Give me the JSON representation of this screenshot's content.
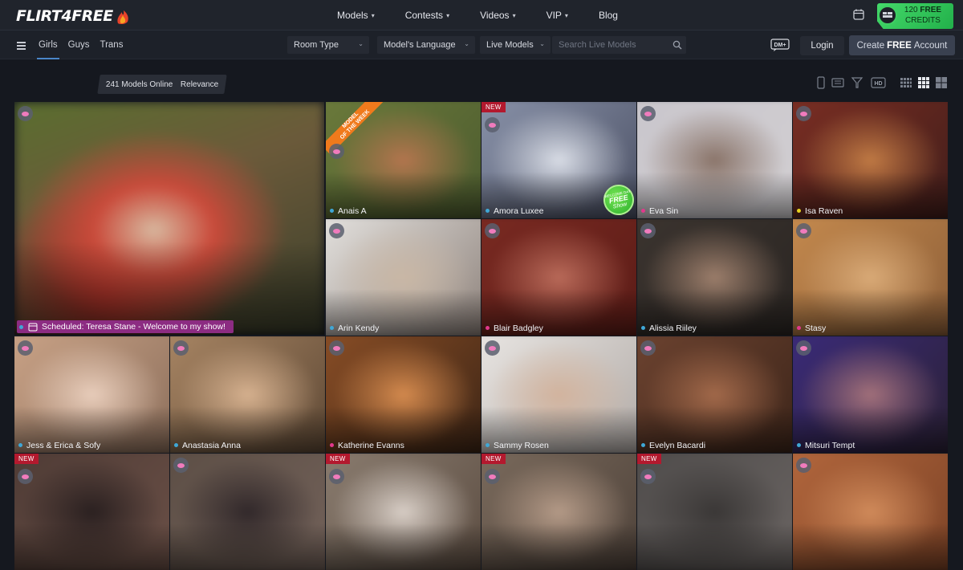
{
  "header": {
    "logo_text": "FLIRT4FREE",
    "nav": [
      {
        "label": "Models",
        "has_dropdown": true
      },
      {
        "label": "Contests",
        "has_dropdown": true
      },
      {
        "label": "Videos",
        "has_dropdown": true
      },
      {
        "label": "VIP",
        "has_dropdown": true
      },
      {
        "label": "Blog",
        "has_dropdown": false
      }
    ],
    "credits": {
      "amount": "120",
      "free": "FREE",
      "label": "CREDITS"
    }
  },
  "subbar": {
    "categories": [
      "Girls",
      "Guys",
      "Trans"
    ],
    "active_category": "Girls",
    "filters": {
      "room_type": "Room Type",
      "language": "Model's Language",
      "live": "Live Models"
    },
    "search_placeholder": "Search Live Models",
    "dm_label": "DM+",
    "login_label": "Login",
    "create_prefix": "Create",
    "create_bold": "FREE",
    "create_suffix": "Account"
  },
  "info": {
    "online": "241 Models Online",
    "sort": "Relevance"
  },
  "badges": {
    "new": "NEW",
    "motw_line1": "MODEL",
    "motw_line2": "OF THE WEEK",
    "welcome_line1": "WELCOME DAY",
    "welcome_line2": "FREE",
    "welcome_line3": "Show",
    "hd": "HD"
  },
  "featured": {
    "scheduled_text": "Scheduled: Teresa Stane - Welcome to my show!",
    "colors": [
      "#5a6e2f",
      "#c94a3a",
      "#d8b9a0",
      "#a8241f"
    ]
  },
  "status_colors": {
    "blue": "#3fa7d6",
    "pink": "#e2388c",
    "yellow": "#e6d11f"
  },
  "models": [
    {
      "name": "Anais A",
      "status": "blue",
      "new": false,
      "badge": "motw",
      "colors": [
        "#6b7a3b",
        "#b3754e",
        "#4b5a2e"
      ]
    },
    {
      "name": "Amora Luxee",
      "status": "blue",
      "new": true,
      "badge": "welcome",
      "colors": [
        "#8a93aa",
        "#d9dde6",
        "#4a4f63"
      ]
    },
    {
      "name": "Eva Sin",
      "status": "pink",
      "new": false,
      "badge": "",
      "colors": [
        "#c9c6cc",
        "#8a7469",
        "#d2cfd2"
      ]
    },
    {
      "name": "Isa Raven",
      "status": "yellow",
      "new": false,
      "badge": "",
      "colors": [
        "#7b2e23",
        "#c07a44",
        "#3f1d1a"
      ]
    },
    {
      "name": "Arin Kendy",
      "status": "blue",
      "new": false,
      "badge": "",
      "colors": [
        "#e5e3e0",
        "#c9b7a5",
        "#8b7f78"
      ]
    },
    {
      "name": "Blair Badgley",
      "status": "pink",
      "new": false,
      "badge": "",
      "colors": [
        "#7a2a22",
        "#b96a59",
        "#5a1b16"
      ]
    },
    {
      "name": "Alissia Riiley",
      "status": "blue",
      "new": false,
      "badge": "",
      "colors": [
        "#3b342f",
        "#9c7e6b",
        "#2a2522"
      ]
    },
    {
      "name": "Stasy",
      "status": "pink",
      "new": false,
      "badge": "",
      "colors": [
        "#c58a4e",
        "#d9aa77",
        "#8b5d37"
      ]
    },
    {
      "name": "Jess & Erica & Sofy",
      "status": "blue",
      "new": false,
      "badge": "",
      "colors": [
        "#caa387",
        "#e8cdbb",
        "#8a6d5a"
      ]
    },
    {
      "name": "Anastasia Anna",
      "status": "blue",
      "new": false,
      "badge": "",
      "colors": [
        "#a98664",
        "#d6b18f",
        "#5b4633"
      ]
    },
    {
      "name": "Katherine Evanns",
      "status": "pink",
      "new": false,
      "badge": "",
      "colors": [
        "#8a4e26",
        "#d48a4e",
        "#3b2415"
      ]
    },
    {
      "name": "Sammy Rosen",
      "status": "blue",
      "new": false,
      "badge": "",
      "colors": [
        "#e9e6e3",
        "#d2b39d",
        "#b0a9a5"
      ]
    },
    {
      "name": "Evelyn Bacardi",
      "status": "blue",
      "new": false,
      "badge": "",
      "colors": [
        "#6d4330",
        "#a2694a",
        "#3b2419"
      ]
    },
    {
      "name": "Mitsuri Tempt",
      "status": "blue",
      "new": false,
      "badge": "",
      "colors": [
        "#3b2b7a",
        "#a2707a",
        "#2a2033"
      ]
    },
    {
      "name": "",
      "status": "",
      "new": true,
      "badge": "",
      "colors": [
        "#4e3b35",
        "#2a2020",
        "#6b5047"
      ]
    },
    {
      "name": "",
      "status": "",
      "new": false,
      "badge": "",
      "colors": [
        "#5c4e45",
        "#31282a",
        "#73625a"
      ]
    },
    {
      "name": "",
      "status": "",
      "new": true,
      "badge": "",
      "colors": [
        "#8b7d70",
        "#d8cec6",
        "#5a4b40"
      ]
    },
    {
      "name": "",
      "status": "",
      "new": true,
      "badge": "",
      "colors": [
        "#7b6b5d",
        "#b49a87",
        "#4c4038"
      ]
    },
    {
      "name": "",
      "status": "",
      "new": true,
      "badge": "",
      "colors": [
        "#4e4b4a",
        "#3a3736",
        "#6b6563"
      ]
    },
    {
      "name": "",
      "status": "",
      "new": false,
      "badge": "",
      "colors": [
        "#b3673d",
        "#d08a5a",
        "#7a4125"
      ]
    }
  ]
}
